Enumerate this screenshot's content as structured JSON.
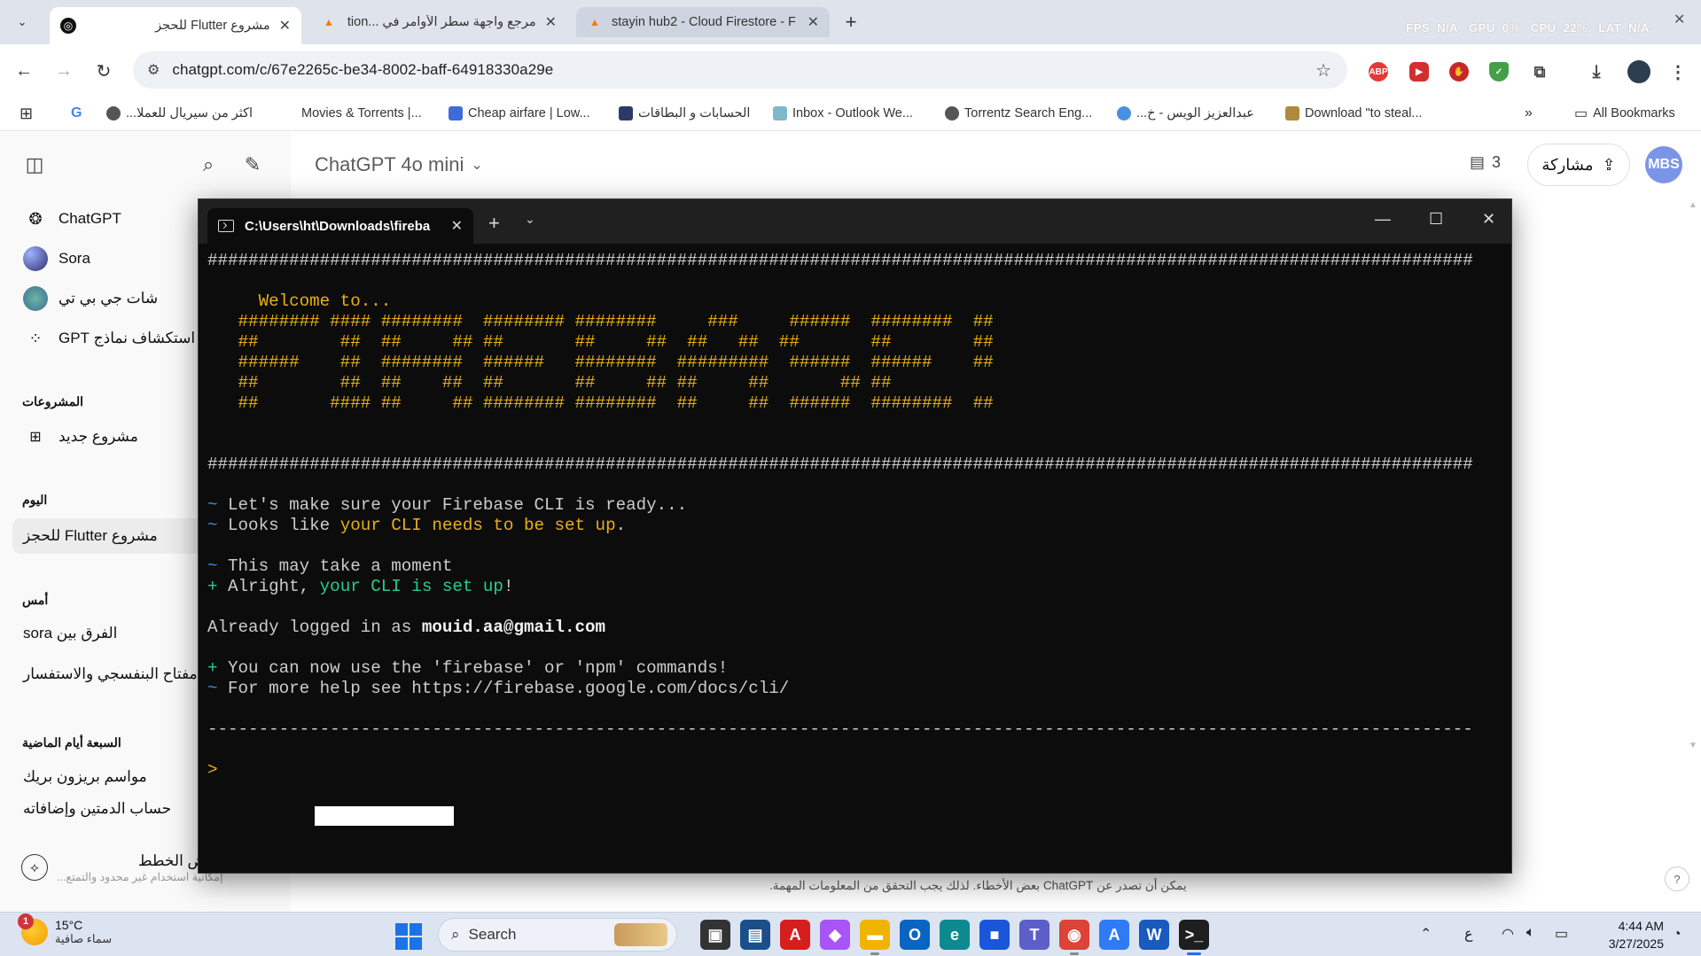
{
  "browser": {
    "tabs": [
      {
        "title": "مشروع Flutter للحجز",
        "favicon": "chatgpt-icon",
        "active": true
      },
      {
        "title": "مرجع واجهة سطر الأوامر في ...tion",
        "favicon": "firebase-icon",
        "active": false
      },
      {
        "title": "stayin hub2 - Cloud Firestore - F",
        "favicon": "firebase-icon",
        "active": false
      }
    ],
    "overlay": {
      "fps": "FPS",
      "fps_val": "N/A",
      "gpu": "GPU",
      "gpu_val": "0%",
      "cpu": "CPU",
      "cpu_val": "22%",
      "lat": "LAT",
      "lat_val": "N/A"
    },
    "url": "chatgpt.com/c/67e2265c-be34-8002-baff-64918330a29e",
    "extensions": [
      {
        "name": "adblock-icon",
        "label": "ABP",
        "color": "#e53935"
      },
      {
        "name": "video-ext-icon",
        "label": "▶",
        "color": "#d32f2f"
      },
      {
        "name": "ublock-icon",
        "label": "✋",
        "color": "#c62828"
      },
      {
        "name": "shield-ext-icon",
        "label": "✓",
        "color": "#43a047"
      }
    ],
    "bookmarks": [
      {
        "label": "",
        "icon": "google-icon",
        "color": "#4285f4"
      },
      {
        "label": "اكثر من سيريال للعملا...",
        "icon": "globe-icon",
        "color": "#555"
      },
      {
        "label": "Movies & Torrents |...",
        "icon": "",
        "color": ""
      },
      {
        "label": "Cheap airfare | Low...",
        "icon": "plane-icon",
        "color": "#3f6bd8"
      },
      {
        "label": "الحسابات و البطاقات",
        "icon": "card-icon",
        "color": "#2b3a67"
      },
      {
        "label": "Inbox - Outlook We...",
        "icon": "outlook-icon",
        "color": "#7fb8c9"
      },
      {
        "label": "Torrentz Search Eng...",
        "icon": "globe-icon",
        "color": "#555"
      },
      {
        "label": "عبدالعزيز الويس - خ...",
        "icon": "drop-icon",
        "color": "#4a90e2"
      },
      {
        "label": "Download \"to steal...",
        "icon": "torrent-icon",
        "color": "#b08a3c"
      }
    ],
    "all_bookmarks": "All Bookmarks"
  },
  "chatgpt": {
    "nav": [
      {
        "label": "ChatGPT",
        "icon": "chatgpt-logo-icon"
      },
      {
        "label": "Sora",
        "icon": "sora-icon"
      },
      {
        "label": "شات جي بي تي",
        "icon": "custom-gpt-icon"
      },
      {
        "label": "استكشاف نماذج GPT",
        "icon": "explore-grid-icon"
      }
    ],
    "projects_heading": "المشروعات",
    "new_project": "مشروع جديد",
    "today_heading": "اليوم",
    "today_items": [
      "مشروع Flutter للحجز"
    ],
    "yesterday_heading": "أمس",
    "yesterday_items": [
      "الفرق بين sora",
      "مفتاح البنفسجي والاستفسار"
    ],
    "week_heading": "السبعة أيام الماضية",
    "week_items": [
      "مواسم بريزون بريك",
      "حساب الدمتين وإضافاته"
    ],
    "plans_title": "عرض الخطط",
    "plans_sub": "إمكانية استخدام غير محدود والتمتع...",
    "model": "ChatGPT 4o mini",
    "doc_count": "3",
    "share": "مشاركة",
    "avatar": "MBS",
    "disclaimer": "يمكن أن تصدر عن ChatGPT بعض الأخطاء. لذلك يجب التحقق من المعلومات المهمة."
  },
  "terminal": {
    "tab_title": "C:\\Users\\ht\\Downloads\\fireba",
    "lines": [
      {
        "segments": [
          {
            "t": "############################################################################################################################",
            "c": ""
          }
        ]
      },
      {
        "segments": []
      },
      {
        "segments": [
          {
            "t": "     Welcome to...",
            "c": "c-yellow"
          }
        ]
      },
      {
        "segments": [
          {
            "t": "   ######## #### ########  ######## ########     ###     ######  ########  ##",
            "c": "c-yellow"
          }
        ]
      },
      {
        "segments": [
          {
            "t": "   ##        ##  ##     ## ##       ##     ##  ##   ##  ##       ##        ##",
            "c": "c-yellow"
          }
        ]
      },
      {
        "segments": [
          {
            "t": "   ######    ##  ########  ######   ########  #########  ######  ######    ##",
            "c": "c-yellow"
          }
        ]
      },
      {
        "segments": [
          {
            "t": "   ##        ##  ##    ##  ##       ##     ## ##     ##       ## ##",
            "c": "c-yellow"
          }
        ]
      },
      {
        "segments": [
          {
            "t": "   ##       #### ##     ## ######## ########  ##     ##  ######  ########  ##",
            "c": "c-yellow"
          }
        ]
      },
      {
        "segments": []
      },
      {
        "segments": []
      },
      {
        "segments": [
          {
            "t": "############################################################################################################################",
            "c": ""
          }
        ]
      },
      {
        "segments": []
      },
      {
        "segments": [
          {
            "t": "~ ",
            "c": "c-blue"
          },
          {
            "t": "Let's make sure your Firebase CLI is ready...",
            "c": ""
          }
        ]
      },
      {
        "segments": [
          {
            "t": "~ ",
            "c": "c-blue"
          },
          {
            "t": "Looks like ",
            "c": ""
          },
          {
            "t": "your CLI needs to be set up",
            "c": "c-yellow"
          },
          {
            "t": ".",
            "c": ""
          }
        ]
      },
      {
        "segments": []
      },
      {
        "segments": [
          {
            "t": "~ ",
            "c": "c-blue"
          },
          {
            "t": "This may take a moment",
            "c": ""
          }
        ]
      },
      {
        "segments": [
          {
            "t": "+ ",
            "c": "c-green"
          },
          {
            "t": "Alright, ",
            "c": ""
          },
          {
            "t": "your CLI is set up",
            "c": "c-green"
          },
          {
            "t": "!",
            "c": ""
          }
        ]
      },
      {
        "segments": []
      },
      {
        "segments": [
          {
            "t": "Already logged in as ",
            "c": ""
          },
          {
            "t": "mouid.aa@gmail.com",
            "c": "c-bold"
          }
        ]
      },
      {
        "segments": []
      },
      {
        "segments": [
          {
            "t": "+ ",
            "c": "c-green"
          },
          {
            "t": "You can now use the 'firebase' or 'npm' commands!",
            "c": ""
          }
        ]
      },
      {
        "segments": [
          {
            "t": "~ ",
            "c": "c-blue"
          },
          {
            "t": "For more help see https://firebase.google.com/docs/cli/",
            "c": ""
          }
        ]
      },
      {
        "segments": []
      },
      {
        "segments": [
          {
            "t": "----------------------------------------------------------------------------------------------------------------------------",
            "c": ""
          }
        ]
      },
      {
        "segments": []
      },
      {
        "segments": [
          {
            "t": ">",
            "c": "c-yellow"
          }
        ]
      }
    ]
  },
  "taskbar": {
    "weather_badge": "1",
    "temperature": "15°C",
    "condition": "سماء صافية",
    "search": "Search",
    "apps": [
      {
        "name": "task-view-icon",
        "glyph": "▣",
        "color": "#333"
      },
      {
        "name": "media-app-icon",
        "glyph": "▤",
        "color": "#1a4f8a"
      },
      {
        "name": "acrobat-icon",
        "glyph": "A",
        "color": "#d71e1e"
      },
      {
        "name": "copilot-icon",
        "glyph": "◆",
        "color": "#a855f7"
      },
      {
        "name": "file-explorer-icon",
        "glyph": "▬",
        "color": "#f0b400"
      },
      {
        "name": "outlook-icon",
        "glyph": "O",
        "color": "#0a64c2"
      },
      {
        "name": "edge-icon",
        "glyph": "e",
        "color": "#0c8a8f"
      },
      {
        "name": "store-icon",
        "glyph": "■",
        "color": "#1a56db"
      },
      {
        "name": "teams-icon",
        "glyph": "T",
        "color": "#5b5fc7"
      },
      {
        "name": "chrome-icon",
        "glyph": "◉",
        "color": "#db4437"
      },
      {
        "name": "app-icon",
        "glyph": "A",
        "color": "#2f7bf6"
      },
      {
        "name": "word-icon",
        "glyph": "W",
        "color": "#185abd"
      },
      {
        "name": "terminal-icon",
        "glyph": ">_",
        "color": "#1e1e1e"
      }
    ],
    "lang": "ع",
    "time": "4:44 AM",
    "date": "3/27/2025"
  }
}
